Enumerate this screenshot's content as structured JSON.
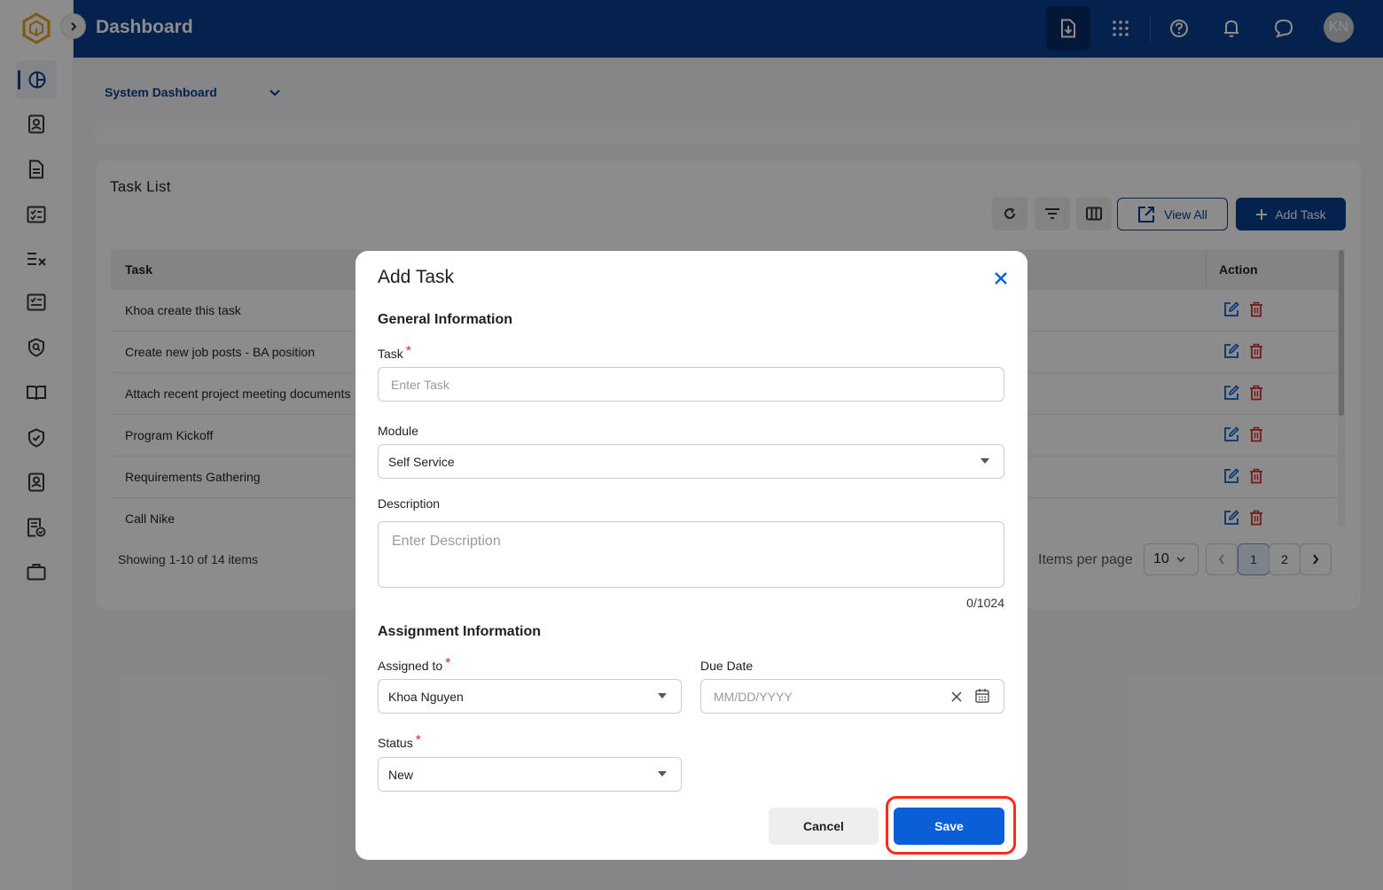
{
  "header": {
    "title": "Dashboard",
    "avatar_initials": "KN",
    "icons": [
      "download-doc-icon",
      "apps-grid-icon",
      "help-icon",
      "bell-icon",
      "chat-icon"
    ]
  },
  "sidebar": {
    "items": [
      "dashboard-icon",
      "contact-card-icon",
      "document-icon",
      "checklist-icon",
      "list-cross-icon",
      "task-icon",
      "shield-search-icon",
      "book-icon",
      "shield-check-icon",
      "user-badge-icon",
      "file-check-icon",
      "briefcase-icon"
    ]
  },
  "dashboard_select": {
    "label": "System Dashboard"
  },
  "task_list": {
    "title": "Task List",
    "view_all_label": "View All",
    "add_task_label": "Add Task",
    "columns": {
      "task": "Task",
      "action": "Action"
    },
    "rows": [
      {
        "task": "Khoa create this task"
      },
      {
        "task": "Create new job posts - BA position"
      },
      {
        "task": "Attach recent project meeting documents"
      },
      {
        "task": "Program Kickoff"
      },
      {
        "task": "Requirements Gathering"
      },
      {
        "task": "Call Nike"
      }
    ],
    "showing": "Showing 1-10 of 14 items",
    "items_per_page_label": "Items per page",
    "items_per_page_value": "10",
    "pages": [
      "1",
      "2"
    ],
    "current_page": "1"
  },
  "modal": {
    "title": "Add Task",
    "general_section": "General Information",
    "task_label": "Task",
    "task_placeholder": "Enter Task",
    "task_value": "",
    "module_label": "Module",
    "module_value": "Self Service",
    "description_label": "Description",
    "description_placeholder": "Enter Description",
    "description_counter": "0/1024",
    "assignment_section": "Assignment Information",
    "assigned_label": "Assigned to",
    "assigned_value": "Khoa Nguyen",
    "due_label": "Due Date",
    "due_placeholder": "MM/DD/YYYY",
    "status_label": "Status",
    "status_value": "New",
    "cancel_label": "Cancel",
    "save_label": "Save"
  },
  "colors": {
    "brand": "#0a3c8c",
    "primary_button": "#0a5ed7",
    "delete": "#d32f2f",
    "highlight": "#ff2a1a"
  }
}
